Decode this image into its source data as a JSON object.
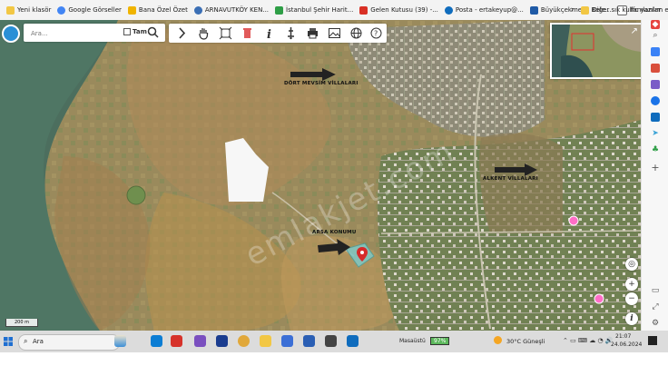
{
  "bookmarks": {
    "items": [
      {
        "label": "Yeni klasör",
        "color": "#f2c744"
      },
      {
        "label": "Google Görseller",
        "color": "#4285f4"
      },
      {
        "label": "Bana Özel Özet",
        "color": "#f0b400"
      },
      {
        "label": "ARNAVUTKÖY KEN...",
        "color": "#3b6fb5"
      },
      {
        "label": "İstanbul Şehir Harit...",
        "color": "#2e9e46"
      },
      {
        "label": "Gelen Kutusu (39) -...",
        "color": "#d93025"
      },
      {
        "label": "Posta - ertakeyup@...",
        "color": "#0f6cbd"
      },
      {
        "label": "Büyükçekmece Bele...",
        "color": "#1f5aa6"
      },
      {
        "label": "ffc yazılım emlak yö...",
        "color": "#666666"
      }
    ],
    "more_label": "Diğer sık kullanılanlar"
  },
  "search": {
    "placeholder": "Ara...",
    "tam_label": "Tam"
  },
  "tools": [
    "chevron-right-icon",
    "pan-hand-icon",
    "extent-icon",
    "delete-icon",
    "info-icon",
    "pin-icon",
    "print-icon",
    "image-icon",
    "globe-icon",
    "help-icon"
  ],
  "map": {
    "scale_label": "200 m",
    "labels": {
      "dort_mevsim": "DÖRT MEVSİM VİLLALARI",
      "alkent": "ALKENT VİLLALARI",
      "arsa": "ARSA KONUMU"
    },
    "watermark": "emlakjet.com"
  },
  "taskbar": {
    "search_label": "Ara",
    "desktop_label": "Masaüstü",
    "battery": "97%",
    "weather": "30°C  Güneşli",
    "time": "21:07",
    "date": "24.06.2024"
  }
}
